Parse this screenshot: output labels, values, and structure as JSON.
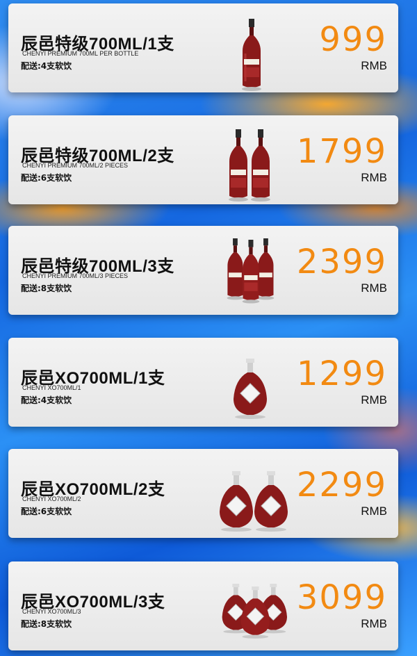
{
  "products": [
    {
      "title": "辰邑特级700ML/1支",
      "subtitle": "CHENYI PREMIUM 700ML PER BOTTLE",
      "delivery": "配送:4支软饮",
      "price": "999",
      "currency": "RMB",
      "bottle_type": "premium-bottle-icon",
      "bottle_count": 1
    },
    {
      "title": "辰邑特级700ML/2支",
      "subtitle": "CHENYI PREMIUM 700ML/2 PIECES",
      "delivery": "配送:6支软饮",
      "price": "1799",
      "currency": "RMB",
      "bottle_type": "premium-bottle-icon",
      "bottle_count": 2
    },
    {
      "title": "辰邑特级700ML/3支",
      "subtitle": "CHENYI PREMIUM 700ML/3 PIECES",
      "delivery": "配送:8支软饮",
      "price": "2399",
      "currency": "RMB",
      "bottle_type": "premium-bottle-icon",
      "bottle_count": 3
    },
    {
      "title": "辰邑XO700ML/1支",
      "subtitle": "CHENYI XO700ML/1",
      "delivery": "配送:4支软饮",
      "price": "1299",
      "currency": "RMB",
      "bottle_type": "xo-bottle-icon",
      "bottle_count": 1
    },
    {
      "title": "辰邑XO700ML/2支",
      "subtitle": "CHENYI XO700ML/2",
      "delivery": "配送:6支软饮",
      "price": "2299",
      "currency": "RMB",
      "bottle_type": "xo-bottle-icon",
      "bottle_count": 2
    },
    {
      "title": "辰邑XO700ML/3支",
      "subtitle": "CHENYI XO700ML/3",
      "delivery": "配送:8支软饮",
      "price": "3099",
      "currency": "RMB",
      "bottle_type": "xo-bottle-icon",
      "bottle_count": 3
    }
  ],
  "colors": {
    "price": "#f28a12",
    "card": "#ececec",
    "wine": "#8a1a1a",
    "background": "#1567e0"
  }
}
